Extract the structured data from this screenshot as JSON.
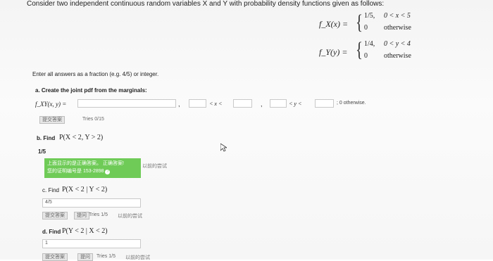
{
  "intro": "Consider two independent continuous random variables X and Y with probability density functions given as follows:",
  "fx": {
    "label": "f_X(x) =",
    "case1_value": "1/5,",
    "case1_cond": "0 < x < 5",
    "case2_value": "0",
    "case2_cond": "otherwise"
  },
  "fy": {
    "label": "f_Y(y) =",
    "case1_value": "1/4,",
    "case1_cond": "0 < y < 4",
    "case2_value": "0",
    "case2_cond": "otherwise"
  },
  "instructions": "Enter all answers as a fraction (e.g. 4/5) or integer.",
  "part_a": {
    "label": "a. Create the joint pdf from the marginals:",
    "fxy_label": "f_XY(x, y) =",
    "x_ineq": "< x <",
    "y_ineq": "< y <",
    "tail": "; 0 otherwise.",
    "submit_label": "提交答案",
    "tries": "Tries 0/15"
  },
  "part_b": {
    "label": "b. Find",
    "expr": "P(X < 2, Y > 2)",
    "answer": "1/5",
    "correct_line1": "上面显示的是正确答案。 正确答案!",
    "correct_line2": "您的证明编号是 153-2898",
    "retry": "以前的尝试"
  },
  "part_c": {
    "label": "c. Find",
    "expr": "P(X < 2 | Y < 2)",
    "answer": "4/5",
    "submit_label": "提交答案",
    "ask_label": "提问",
    "tries": "Tries 1/5",
    "retry": "以前的尝试"
  },
  "part_d": {
    "label": "d. Find",
    "expr": "P(Y < 2 | X < 2)",
    "answer": "1",
    "submit_label": "提交答案",
    "ask_label": "提问",
    "tries": "Tries 1/5",
    "retry": "以前的尝试"
  },
  "colors": {
    "correct_bg": "#6fcb57"
  }
}
